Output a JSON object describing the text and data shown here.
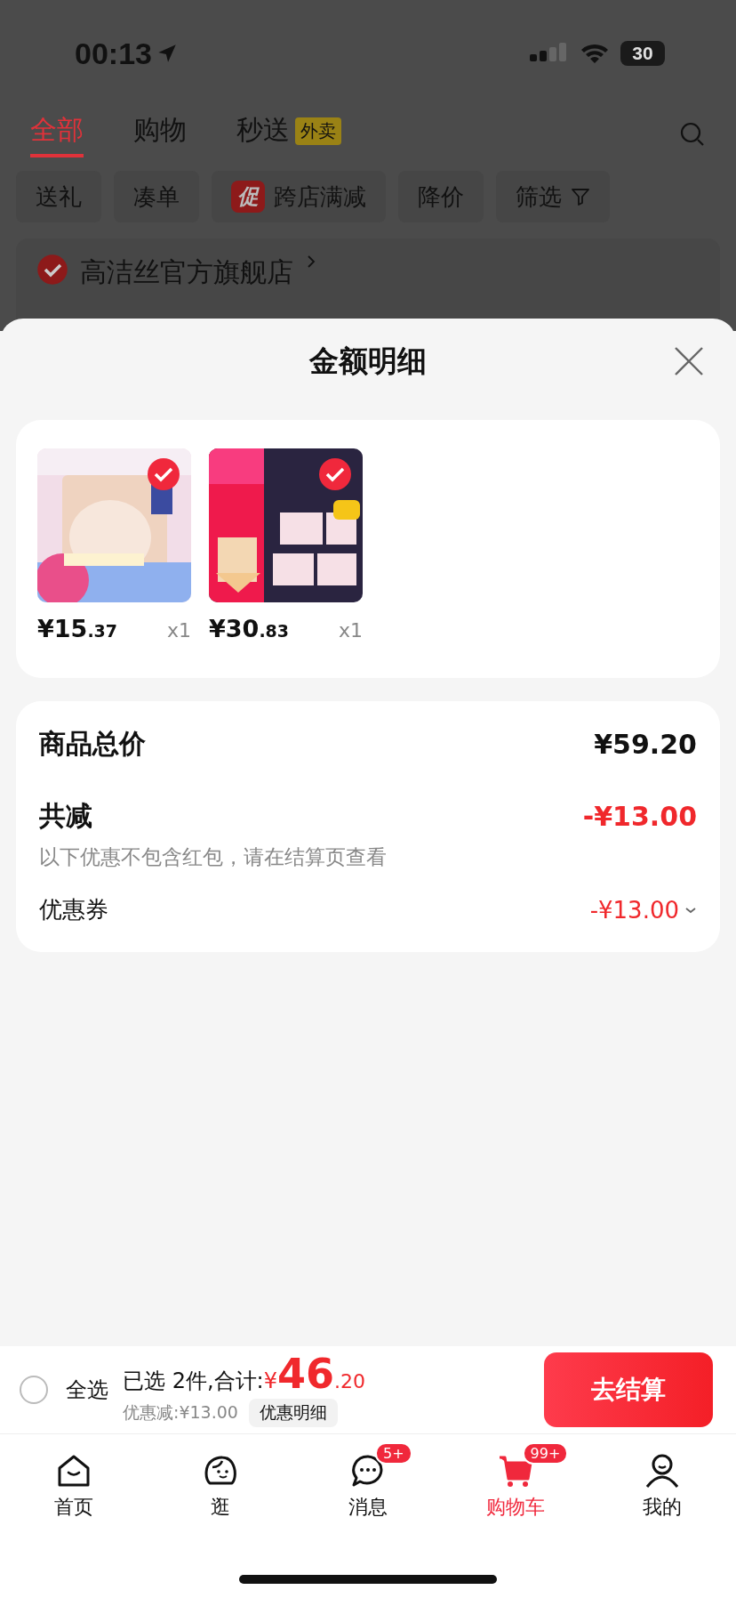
{
  "status_bar": {
    "time": "00:13",
    "battery": "30"
  },
  "top_tabs": [
    {
      "label": "全部",
      "selected": true
    },
    {
      "label": "购物",
      "selected": false
    },
    {
      "label": "秒送",
      "selected": false,
      "badge": "外卖"
    }
  ],
  "filter_chips": [
    {
      "label": "送礼",
      "kind": "plain"
    },
    {
      "label": "凑单",
      "kind": "plain"
    },
    {
      "label": "跨店满减",
      "kind": "promo",
      "tag": "促"
    },
    {
      "label": "降价",
      "kind": "plain"
    },
    {
      "label": "筛选",
      "kind": "filter"
    }
  ],
  "store": {
    "name": "高洁丝官方旗舰店",
    "checked": true
  },
  "sheet": {
    "title": "金额明细",
    "items": [
      {
        "price_main": "¥15",
        "price_cents": ".37",
        "quantity": "x1",
        "checked": true
      },
      {
        "price_main": "¥30",
        "price_cents": ".83",
        "quantity": "x1",
        "checked": true
      }
    ],
    "summary": {
      "total_label": "商品总价",
      "total": "¥59.20",
      "discount_label": "共减",
      "discount": "-¥13.00",
      "note": "以下优惠不包含红包，请在结算页查看",
      "coupon_label": "优惠券",
      "coupon_value": "-¥13.00"
    }
  },
  "checkout": {
    "select_all_label": "全选",
    "select_all_checked": false,
    "selected_text": "已选 2件,合计:",
    "currency": "¥",
    "total_main": "46",
    "total_cents": ".20",
    "saving": "优惠减:¥13.00",
    "detail_button": "优惠明细",
    "checkout_button": "去结算"
  },
  "nav": [
    {
      "label": "首页",
      "kind": "home",
      "selected": false
    },
    {
      "label": "逛",
      "kind": "browse",
      "selected": false
    },
    {
      "label": "消息",
      "kind": "message",
      "selected": false,
      "badge": "5+"
    },
    {
      "label": "购物车",
      "kind": "cart",
      "selected": true,
      "badge": "99+"
    },
    {
      "label": "我的",
      "kind": "me",
      "selected": false
    }
  ]
}
